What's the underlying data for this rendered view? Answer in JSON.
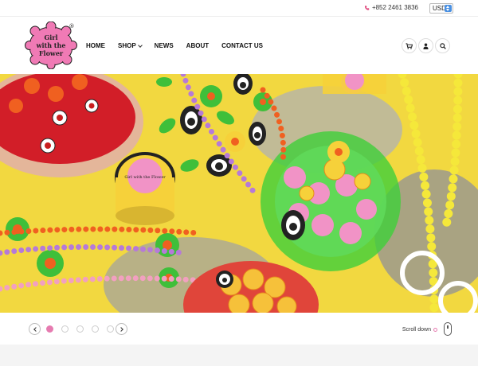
{
  "topbar": {
    "phone": "+852 2461 3836",
    "currency": "USD",
    "phone_icon": "phone-icon",
    "currency_arrow_icon": "select-arrows-icon"
  },
  "logo": {
    "line1": "Girl",
    "line2": "with the",
    "line3": "Flower",
    "registered_mark": "®"
  },
  "nav": {
    "items": [
      {
        "label": "HOME"
      },
      {
        "label": "SHOP"
      },
      {
        "label": "NEWS"
      },
      {
        "label": "ABOUT"
      },
      {
        "label": "CONTACT US"
      }
    ]
  },
  "header_icons": [
    "cart-icon",
    "user-icon",
    "search-icon"
  ],
  "hero": {
    "image": "product-photo-colorful-beads-and-candy",
    "jar_label": "Girl with the Flower"
  },
  "slider": {
    "slides": 6,
    "active_slide": 1,
    "scroll_label": "Scroll down"
  },
  "colors": {
    "accent_pink": "#e67bb0",
    "hero_yellow": "#f2d840",
    "select_blue": "#4a90e2"
  }
}
